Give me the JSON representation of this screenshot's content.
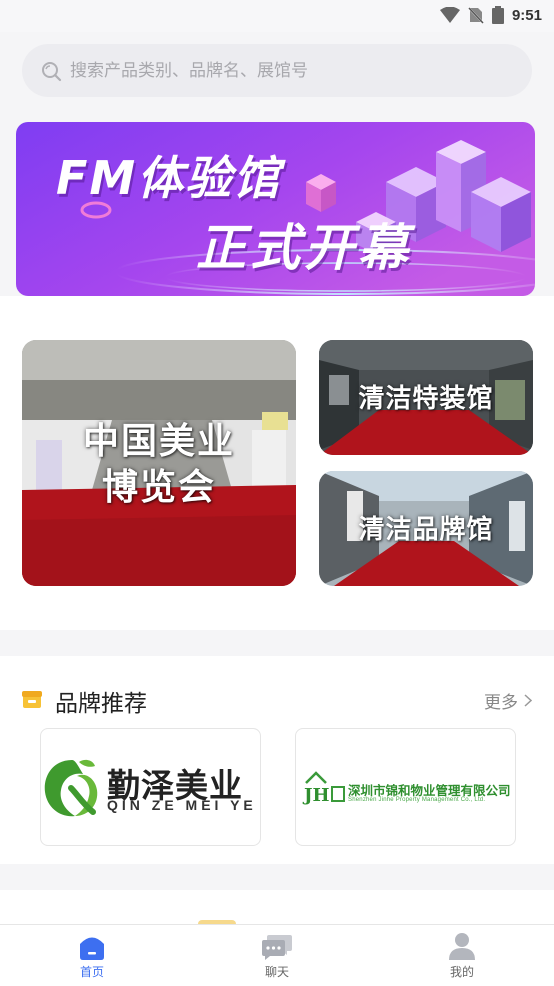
{
  "status_bar": {
    "time": "9:51"
  },
  "search": {
    "placeholder": "搜索产品类别、品牌名、展馆号"
  },
  "banner": {
    "title": "FM体验馆",
    "subtitle": "正式开幕"
  },
  "halls": [
    {
      "label_line1": "中国美业",
      "label_line2": "博览会"
    },
    {
      "label": "清洁特装馆"
    },
    {
      "label": "清洁品牌馆"
    }
  ],
  "brands": {
    "title": "品牌推荐",
    "more_label": "更多",
    "items": [
      {
        "name": "勤泽美业",
        "pinyin": "QIN ZE MEI YE"
      },
      {
        "name": "深圳市锦和物业管理有限公司",
        "english": "Shenzhen Jinhe Property Management Co., Ltd."
      }
    ]
  },
  "tabbar": {
    "items": [
      {
        "label": "首页",
        "active": true
      },
      {
        "label": "聊天",
        "active": false
      },
      {
        "label": "我的",
        "active": false
      }
    ]
  },
  "colors": {
    "accent": "#3d6ff0",
    "banner_start": "#7b3cf0",
    "banner_end": "#c04fe8",
    "carpet": "#b0141c",
    "brand_green": "#2f8f2f"
  }
}
